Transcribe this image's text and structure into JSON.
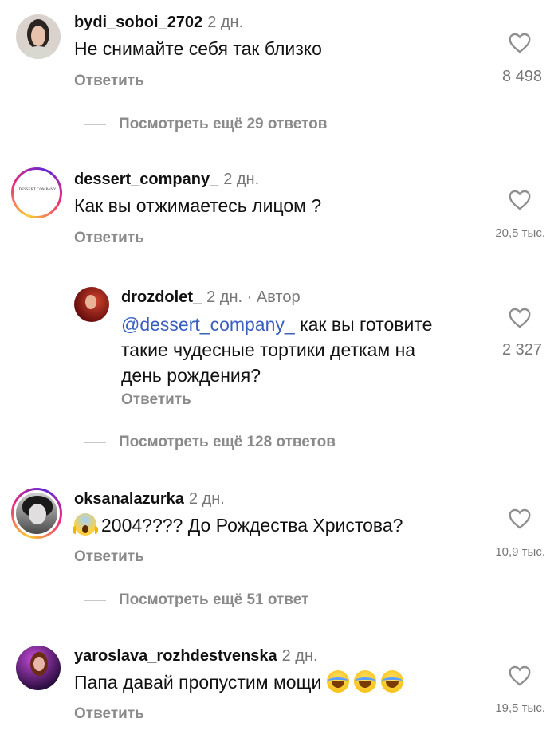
{
  "comments": [
    {
      "username": "bydi_soboi_2702",
      "time": "2 дн.",
      "text": "Не снимайте себя так близко",
      "reply": "Ответить",
      "likes": "8 498",
      "view_replies": "Посмотреть ещё 29 ответов"
    },
    {
      "username": "dessert_company_",
      "time": "2 дн.",
      "text": "Как вы отжимаетесь лицом ?",
      "reply": "Ответить",
      "likes": "20,5 тыс.",
      "avatar_text": "DESSERT COMPANY"
    },
    {
      "username": "drozdolet_",
      "time": "2 дн.",
      "author_sep": " · ",
      "author_label": "Автор",
      "mention": "@dessert_company_",
      "text_line1": " как вы готовите",
      "text_line2": "такие чудесные тортики деткам на",
      "text_line3": "день рождения?",
      "reply": "Ответить",
      "likes": "2 327",
      "view_replies": "Посмотреть ещё 128 ответов"
    },
    {
      "username": "oksanalazurka",
      "time": "2 дн.",
      "text": "2004???? До Рождества Христова?",
      "reply": "Ответить",
      "likes": "10,9 тыс.",
      "view_replies": "Посмотреть ещё 51 ответ"
    },
    {
      "username": "yaroslava_rozhdestvenska",
      "time": "2 дн.",
      "text": "Папа давай пропустим мощи",
      "reply": "Ответить",
      "likes": "19,5 тыс."
    }
  ]
}
